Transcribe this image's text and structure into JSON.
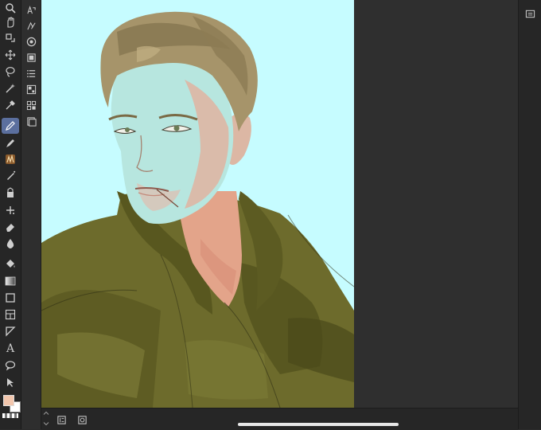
{
  "app": {
    "name": "drawing-app"
  },
  "toolbar": {
    "tools": [
      {
        "id": "zoom",
        "icon": "magnifier-icon"
      },
      {
        "id": "hand",
        "icon": "hand-icon"
      },
      {
        "id": "rotate",
        "icon": "rotate-icon"
      },
      {
        "id": "move",
        "icon": "move-icon"
      },
      {
        "id": "lasso",
        "icon": "lasso-icon"
      },
      {
        "id": "magic-wand",
        "icon": "magic-wand-icon"
      },
      {
        "id": "eyedropper",
        "icon": "eyedropper-icon"
      },
      {
        "id": "pen",
        "icon": "pen-icon",
        "active": true
      },
      {
        "id": "pencil",
        "icon": "pencil-icon"
      },
      {
        "id": "brush",
        "icon": "brush-icon"
      },
      {
        "id": "airbrush",
        "icon": "airbrush-icon"
      },
      {
        "id": "decoration",
        "icon": "decoration-icon"
      },
      {
        "id": "sparkle",
        "icon": "sparkle-icon"
      },
      {
        "id": "eraser",
        "icon": "eraser-icon"
      },
      {
        "id": "blend",
        "icon": "blend-icon"
      },
      {
        "id": "fill",
        "icon": "fill-bucket-icon"
      },
      {
        "id": "gradient",
        "icon": "gradient-icon"
      },
      {
        "id": "shape",
        "icon": "square-shape-icon"
      },
      {
        "id": "frame",
        "icon": "frame-icon"
      },
      {
        "id": "ruler",
        "icon": "ruler-triangle-icon"
      },
      {
        "id": "text",
        "icon": "text-icon",
        "glyph": "A"
      },
      {
        "id": "balloon",
        "icon": "speech-balloon-icon"
      },
      {
        "id": "correct-line",
        "icon": "correct-line-icon"
      }
    ],
    "colors": {
      "main": "#f2c6ad",
      "sub": "#ffffff"
    }
  },
  "canvas": {
    "background_color": "#c6fcff",
    "subject": "portrait-illustration"
  },
  "bottom_bar": {
    "left_icons": [
      "layer-list-icon",
      "navigator-icon"
    ]
  },
  "right_bar": {
    "icons": [
      "folder-icon"
    ]
  }
}
